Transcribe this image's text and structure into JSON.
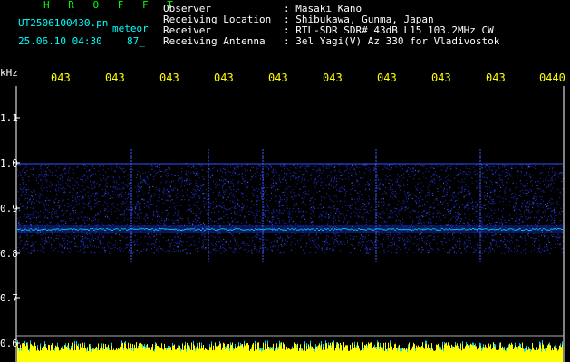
{
  "app": {
    "title": "H R O F F T"
  },
  "file": {
    "name": "UT2506100430.pn",
    "mode": "meteor",
    "datetime": "25.06.10 04:30",
    "count": "87_"
  },
  "info": [
    {
      "label": "Observer",
      "value": ": Masaki Kano"
    },
    {
      "label": "Receiving Location",
      "value": ": Shibukawa, Gunma, Japan"
    },
    {
      "label": "Receiver",
      "value": ": RTL-SDR SDR# 43dB L15 103.2MHz CW"
    },
    {
      "label": "Receiving Antenna",
      "value": ": 3el Yagi(V) Az 330 for Vladivostok"
    }
  ],
  "axis": {
    "unit": "kHz",
    "y_ticks": [
      "1.1",
      "1.0",
      "0.9",
      "0.8",
      "0.7",
      "0.6"
    ],
    "time_ticks": [
      "043",
      "043",
      "043",
      "043",
      "043",
      "043",
      "043",
      "043",
      "043",
      "0440"
    ]
  },
  "colors": {
    "background": "#000000",
    "title": "#00ff00",
    "file": "#00ffff",
    "ticks": "#ffff00",
    "text": "#ffffff",
    "spectrum": "#0000ff",
    "signal": "#00ffff",
    "bottom_bar": "#ffff00"
  }
}
